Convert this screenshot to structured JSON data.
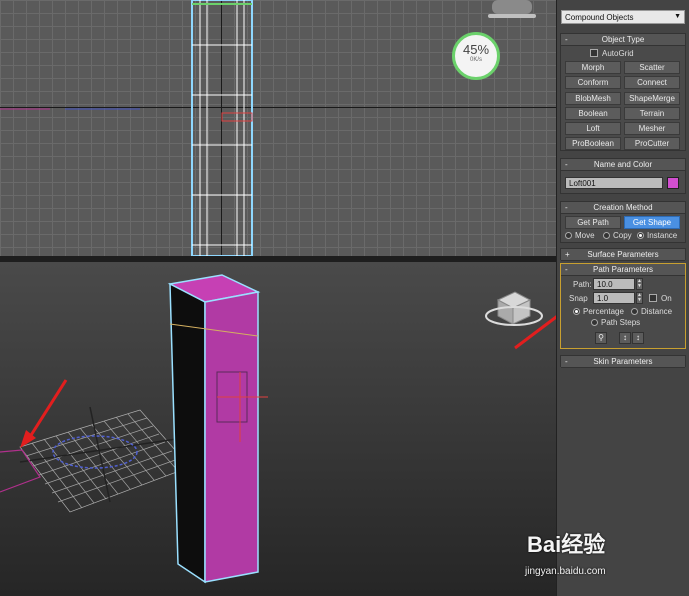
{
  "perf_meter": {
    "percent": "45%",
    "rate": "0K/s"
  },
  "panel": {
    "dropdown": "Compound Objects",
    "object_type": {
      "title": "Object Type",
      "autogrid": "AutoGrid",
      "buttons": [
        "Morph",
        "Scatter",
        "Conform",
        "Connect",
        "BlobMesh",
        "ShapeMerge",
        "Boolean",
        "Terrain",
        "Loft",
        "Mesher",
        "ProBoolean",
        "ProCutter"
      ]
    },
    "name_color": {
      "title": "Name and Color",
      "name": "Loft001",
      "color": "#d24fd0"
    },
    "creation_method": {
      "title": "Creation Method",
      "get_path": "Get Path",
      "get_shape": "Get Shape",
      "move": "Move",
      "copy": "Copy",
      "instance": "Instance"
    },
    "surface_params": {
      "title": "Surface Parameters",
      "sign": "+"
    },
    "path_params": {
      "title": "Path Parameters",
      "path_label": "Path:",
      "path_value": "10.0",
      "snap_label": "Snap",
      "snap_value": "1.0",
      "on_label": "On",
      "percentage": "Percentage",
      "distance": "Distance",
      "path_steps": "Path Steps"
    },
    "skin_params": {
      "title": "Skin Parameters",
      "sign": "-"
    }
  },
  "watermark": {
    "logo": "Bai经验",
    "url": "jingyan.baidu.com"
  }
}
